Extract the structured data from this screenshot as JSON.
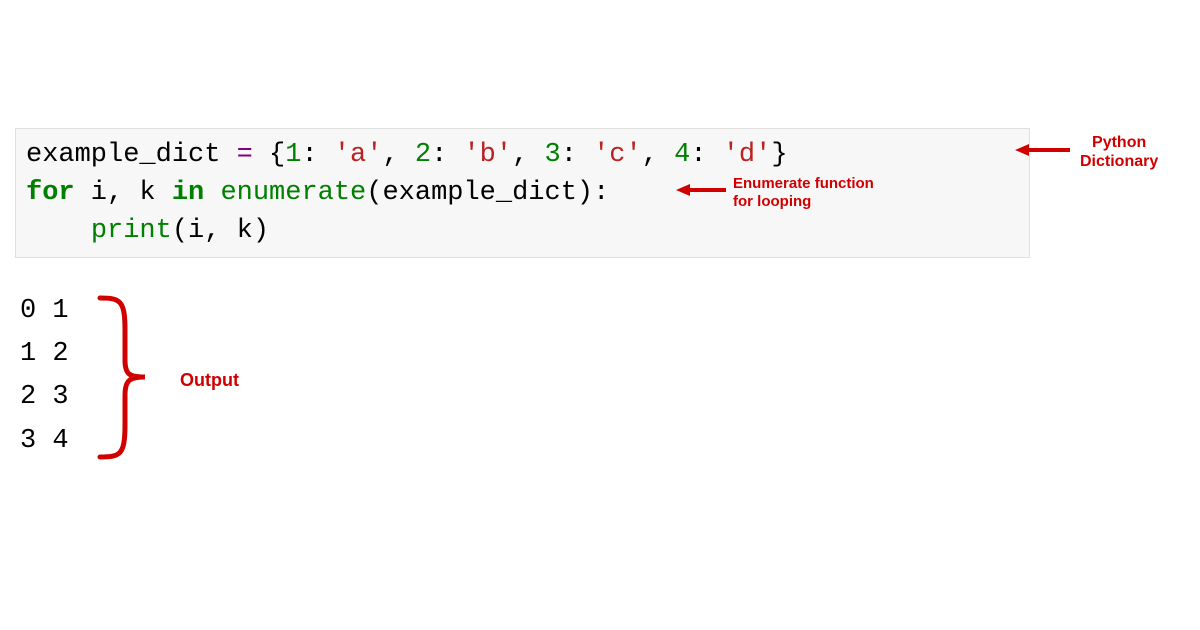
{
  "code": {
    "line1": {
      "t1": "example_dict ",
      "t2": "=",
      "t3": " {",
      "t4": "1",
      "t5": ": ",
      "t6": "'a'",
      "t7": ", ",
      "t8": "2",
      "t9": ": ",
      "t10": "'b'",
      "t11": ", ",
      "t12": "3",
      "t13": ": ",
      "t14": "'c'",
      "t15": ", ",
      "t16": "4",
      "t17": ": ",
      "t18": "'d'",
      "t19": "}"
    },
    "line2": {
      "t1": "for",
      "t2": " i, k ",
      "t3": "in",
      "t4": " ",
      "t5": "enumerate",
      "t6": "(example_dict):"
    },
    "line3": {
      "t1": "    ",
      "t2": "print",
      "t3": "(i, k)"
    }
  },
  "output": {
    "l1": "0 1",
    "l2": "1 2",
    "l3": "2 3",
    "l4": "3 4"
  },
  "annotations": {
    "dict_label_1": "Python",
    "dict_label_2": "Dictionary",
    "enum_label_1": "Enumerate function",
    "enum_label_2": "for looping",
    "output_label": "Output"
  }
}
